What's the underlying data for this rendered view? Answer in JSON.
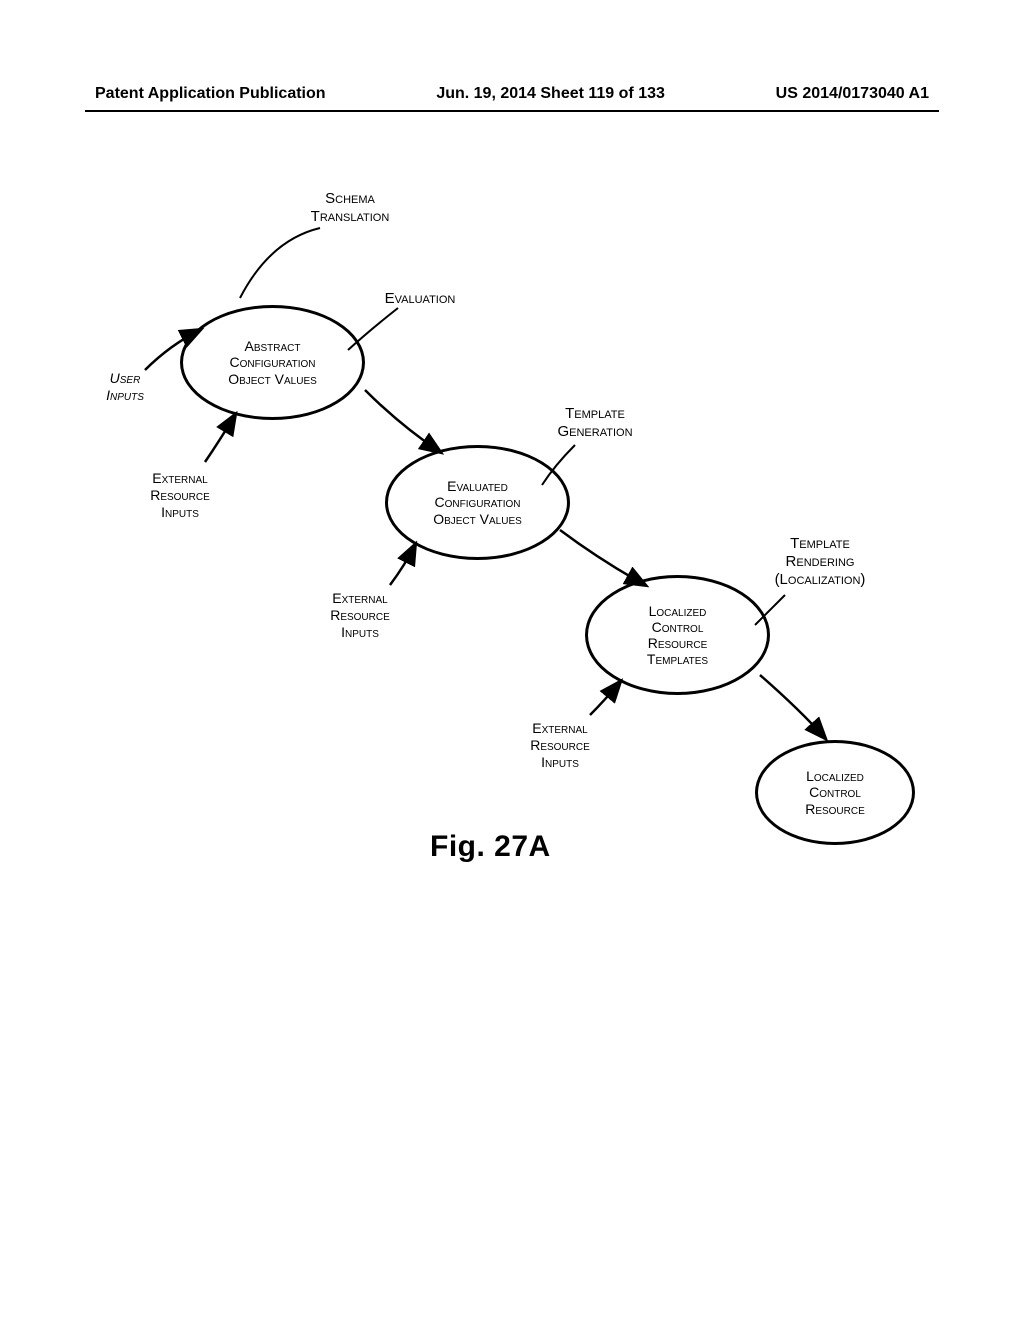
{
  "header": {
    "left": "Patent Application Publication",
    "center": "Jun. 19, 2014  Sheet 119 of 133",
    "right": "US 2014/0173040 A1"
  },
  "figure_label": "Fig. 27A",
  "nodes": {
    "abstract": "Abstract\nConfiguration\nObject Values",
    "evaluated": "Evaluated\nConfiguration\nObject Values",
    "templates": "Localized\nControl\nResource\nTemplates",
    "resource": "Localized\nControl\nResource"
  },
  "processes": {
    "schema": "Schema\nTranslation",
    "evaluation": "Evaluation",
    "tmpl_gen": "Template\nGeneration",
    "tmpl_render": "Template\nRendering\n(Localization)"
  },
  "inputs": {
    "user": "User\nInputs",
    "ext1": "External\nResource\nInputs",
    "ext2": "External\nResource\nInputs",
    "ext3": "External\nResource\nInputs"
  }
}
